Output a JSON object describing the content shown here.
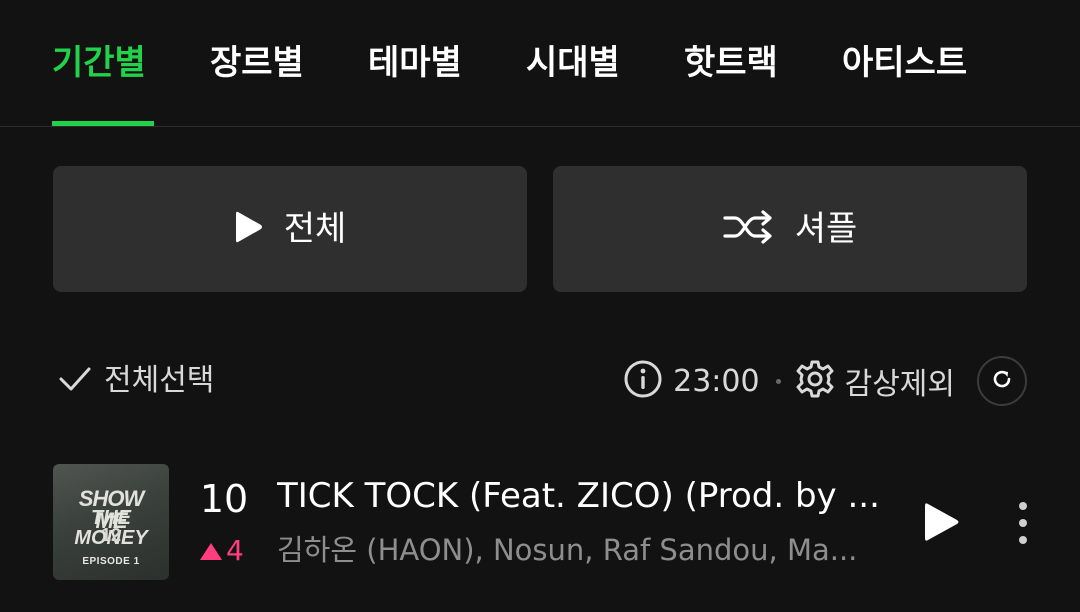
{
  "tabs": [
    {
      "label": "기간별",
      "active": true
    },
    {
      "label": "장르별",
      "active": false
    },
    {
      "label": "테마별",
      "active": false
    },
    {
      "label": "시대별",
      "active": false
    },
    {
      "label": "핫트랙",
      "active": false
    },
    {
      "label": "아티스트",
      "active": false
    }
  ],
  "actions": {
    "play_all_label": "전체",
    "shuffle_label": "셔플"
  },
  "toolbar": {
    "select_all_label": "전체선택",
    "time": "23:00",
    "exclude_label": "감상제외"
  },
  "song": {
    "rank": "10",
    "rank_change": "4",
    "rank_change_direction": "up",
    "title": "TICK TOCK (Feat. ZICO) (Prod. by ...",
    "artist": "김하온 (HAON), Nosun, Raf Sandou, Ma...",
    "album_art": {
      "line1": "SHOW ME",
      "line2": "THE MONEY",
      "line3": "12",
      "line4": "EPISODE 1"
    }
  },
  "colors": {
    "accent": "#22d24b",
    "background": "#121212",
    "button_bg": "#2f2f2f",
    "rank_up": "#ff3d7f",
    "muted_text": "#8e8e8e"
  },
  "icons": [
    "play-icon",
    "shuffle-icon",
    "check-icon",
    "info-icon",
    "gear-icon",
    "refresh-icon",
    "more-vertical-icon"
  ]
}
